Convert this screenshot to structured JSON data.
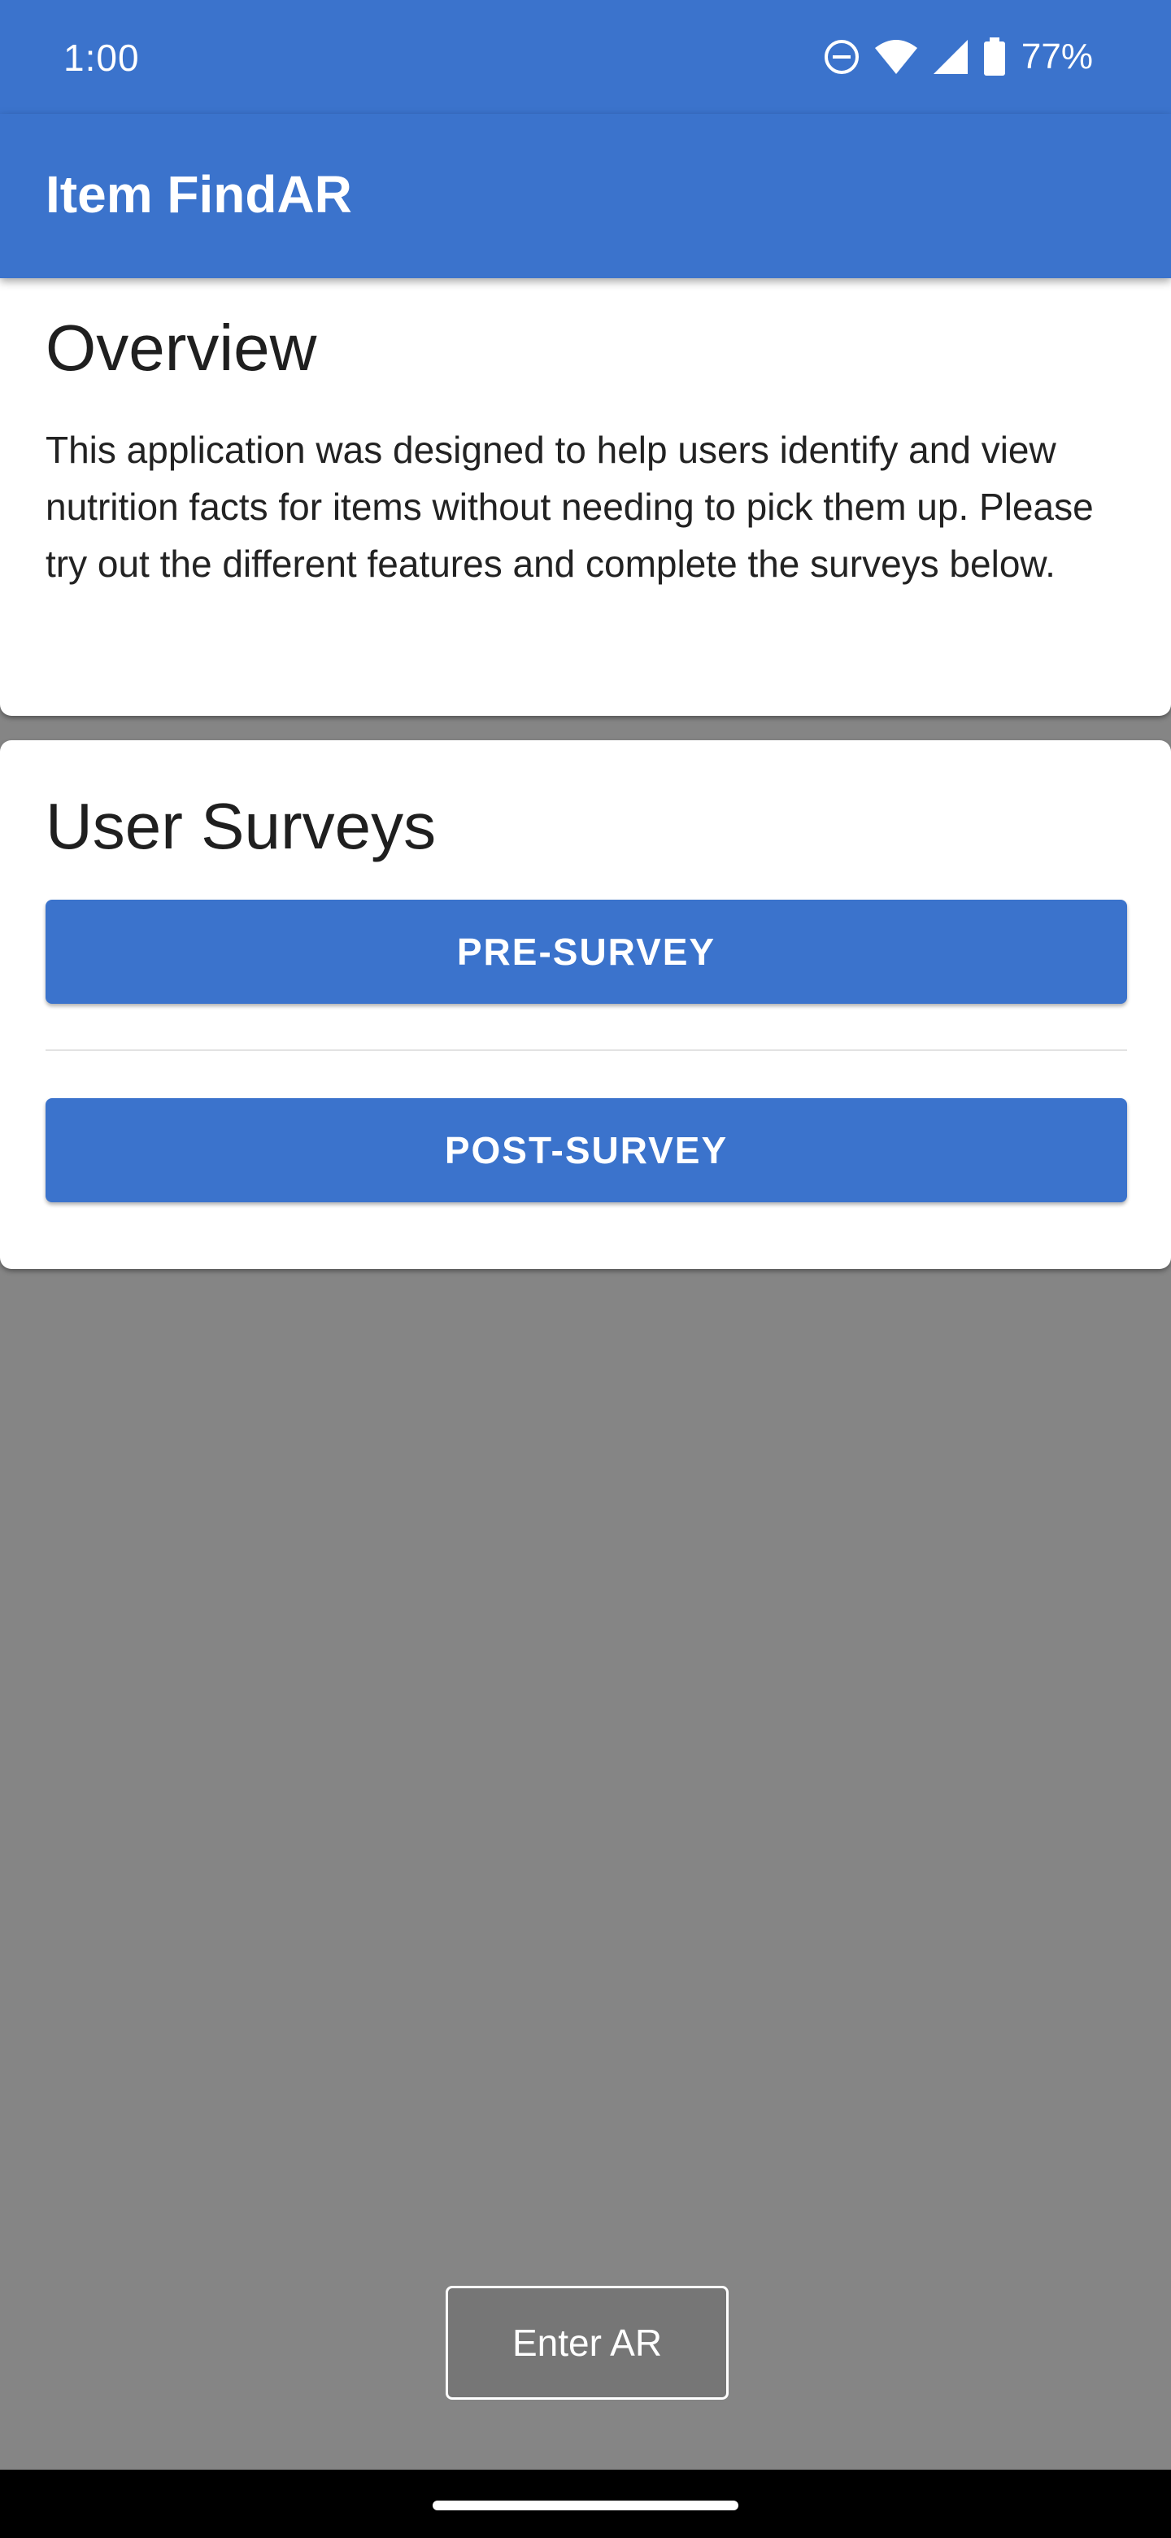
{
  "status_bar": {
    "time": "1:00",
    "battery_percent": "77%",
    "icons": [
      "dnd-icon",
      "wifi-icon",
      "cell-signal-icon",
      "battery-icon"
    ]
  },
  "app_bar": {
    "title": "Item FindAR"
  },
  "overview": {
    "title": "Overview",
    "body": "This application was designed to help users identify and view nutrition facts for items without needing to pick them up. Please try out the different features and complete the surveys below."
  },
  "surveys": {
    "title": "User Surveys",
    "pre_label": "PRE-SURVEY",
    "post_label": "POST-SURVEY"
  },
  "ar": {
    "enter_label": "Enter AR"
  },
  "colors": {
    "primary": "#3b73cc",
    "background": "#858585",
    "card": "#ffffff",
    "nav_bar": "#000000"
  }
}
